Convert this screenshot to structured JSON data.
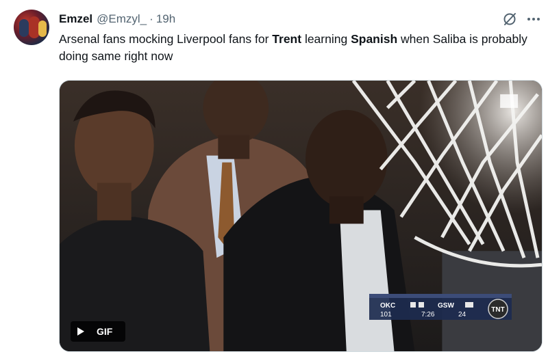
{
  "tweet": {
    "author_name": "Emzel",
    "author_handle": "@Emzyl_",
    "separator": "·",
    "timestamp": "19h",
    "text_parts": [
      {
        "text": "Arsenal fans mocking Liverpool fans for ",
        "bold": false
      },
      {
        "text": "Trent",
        "bold": true
      },
      {
        "text": " learning ",
        "bold": false
      },
      {
        "text": "Spanish",
        "bold": true
      },
      {
        "text": " when Saliba is probably doing same right now",
        "bold": false
      }
    ]
  },
  "media": {
    "type": "gif",
    "badge_label": "GIF",
    "scorebug": {
      "away_team": "OKC",
      "away_score": "101",
      "home_team": "GSW",
      "home_score": "24",
      "clock": "7:26",
      "network": "TNT"
    }
  },
  "icons": {
    "avatar": "avatar-image",
    "grok": "grok-icon",
    "more": "more-options-icon",
    "play": "play-icon"
  },
  "colors": {
    "text_primary": "#0f1419",
    "text_secondary": "#536471",
    "media_border": "#cfd9de"
  }
}
